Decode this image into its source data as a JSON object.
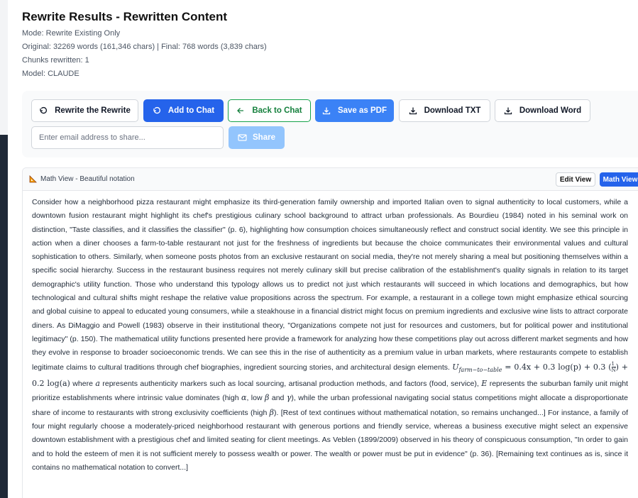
{
  "header": {
    "title": "Rewrite Results - Rewritten Content",
    "mode": "Mode: Rewrite Existing Only",
    "stats": "Original: 32269 words (161,346 chars) | Final: 768 words (3,839 chars)",
    "chunks": "Chunks rewritten: 1",
    "model": "Model: CLAUDE"
  },
  "toolbar": {
    "rewrite_label": "Rewrite the Rewrite",
    "add_chat_label": "Add to Chat",
    "back_chat_label": "Back to Chat",
    "save_pdf_label": "Save as PDF",
    "download_txt_label": "Download TXT",
    "download_word_label": "Download Word",
    "email_placeholder": "Enter email address to share...",
    "share_label": "Share"
  },
  "viewer": {
    "mode_label": "Math View - Beautiful notation",
    "edit_view_label": "Edit View",
    "math_view_label": "Math View"
  },
  "content": {
    "part1": "Consider how a neighborhood pizza restaurant might emphasize its third-generation family ownership and imported Italian oven to signal authenticity to local customers, while a downtown fusion restaurant might highlight its chef's prestigious culinary school background to attract urban professionals. As Bourdieu (1984) noted in his seminal work on distinction, \"Taste classifies, and it classifies the classifier\" (p. 6), highlighting how consumption choices simultaneously reflect and construct social identity. We see this principle in action when a diner chooses a farm-to-table restaurant not just for the freshness of ingredients but because the choice communicates their environmental values and cultural sophistication to others. Similarly, when someone posts photos from an exclusive restaurant on social media, they're not merely sharing a meal but positioning themselves within a specific social hierarchy. Success in the restaurant business requires not merely culinary skill but precise calibration of the establishment's quality signals in relation to its target demographic's utility function. Those who understand this typology allows us to predict not just which restaurants will succeed in which locations and demographics, but how technological and cultural shifts might reshape the relative value propositions across the spectrum. For example, a restaurant in a college town might emphasize ethical sourcing and global cuisine to appeal to educated young consumers, while a steakhouse in a financial district might focus on premium ingredients and exclusive wine lists to attract corporate diners. As DiMaggio and Powell (1983) observe in their institutional theory, \"Organizations compete not just for resources and customers, but for political power and institutional legitimacy\" (p. 150). The mathematical utility functions presented here provide a framework for analyzing how these competitions play out across different market segments and how they evolve in response to broader socioeconomic trends. We can see this in the rise of authenticity as a premium value in urban markets, where restaurants compete to establish legitimate claims to cultural traditions through chef biographies, ingredient sourcing stories, and architectural design elements.",
    "eq_u": "U",
    "eq_sub": "farm−to−table",
    "eq_body": " = 0.4x + 0.3 log(p) + 0.3 (",
    "eq_frac_num": "1",
    "eq_frac_den": "N",
    "eq_tail": ") + 0.2 log(a)",
    "part2": " where ",
    "var_a": "a",
    "part3": " represents authenticity markers such as local sourcing, artisanal production methods, and factors (food, service), ",
    "var_E": "E",
    "part4": " represents the suburban family unit might prioritize establishments where intrinsic value dominates (high ",
    "var_alpha": "α",
    "part5": ", low ",
    "var_beta": "β",
    "part6": " and ",
    "var_gamma": "γ",
    "part7": "), while the urban professional navigating social status competitions might allocate a disproportionate share of income to restaurants with strong exclusivity coefficients (high ",
    "var_beta2": "β",
    "part8": "). [Rest of text continues without mathematical notation, so remains unchanged...] For instance, a family of four might regularly choose a moderately-priced neighborhood restaurant with generous portions and friendly service, whereas a business executive might select an expensive downtown establishment with a prestigious chef and limited seating for client meetings. As Veblen (1899/2009) observed in his theory of conspicuous consumption, \"In order to gain and to hold the esteem of men it is not sufficient merely to possess wealth or power. The wealth or power must be put in evidence\" (p. 36). [Remaining text continues as is, since it contains no mathematical notation to convert...]"
  }
}
